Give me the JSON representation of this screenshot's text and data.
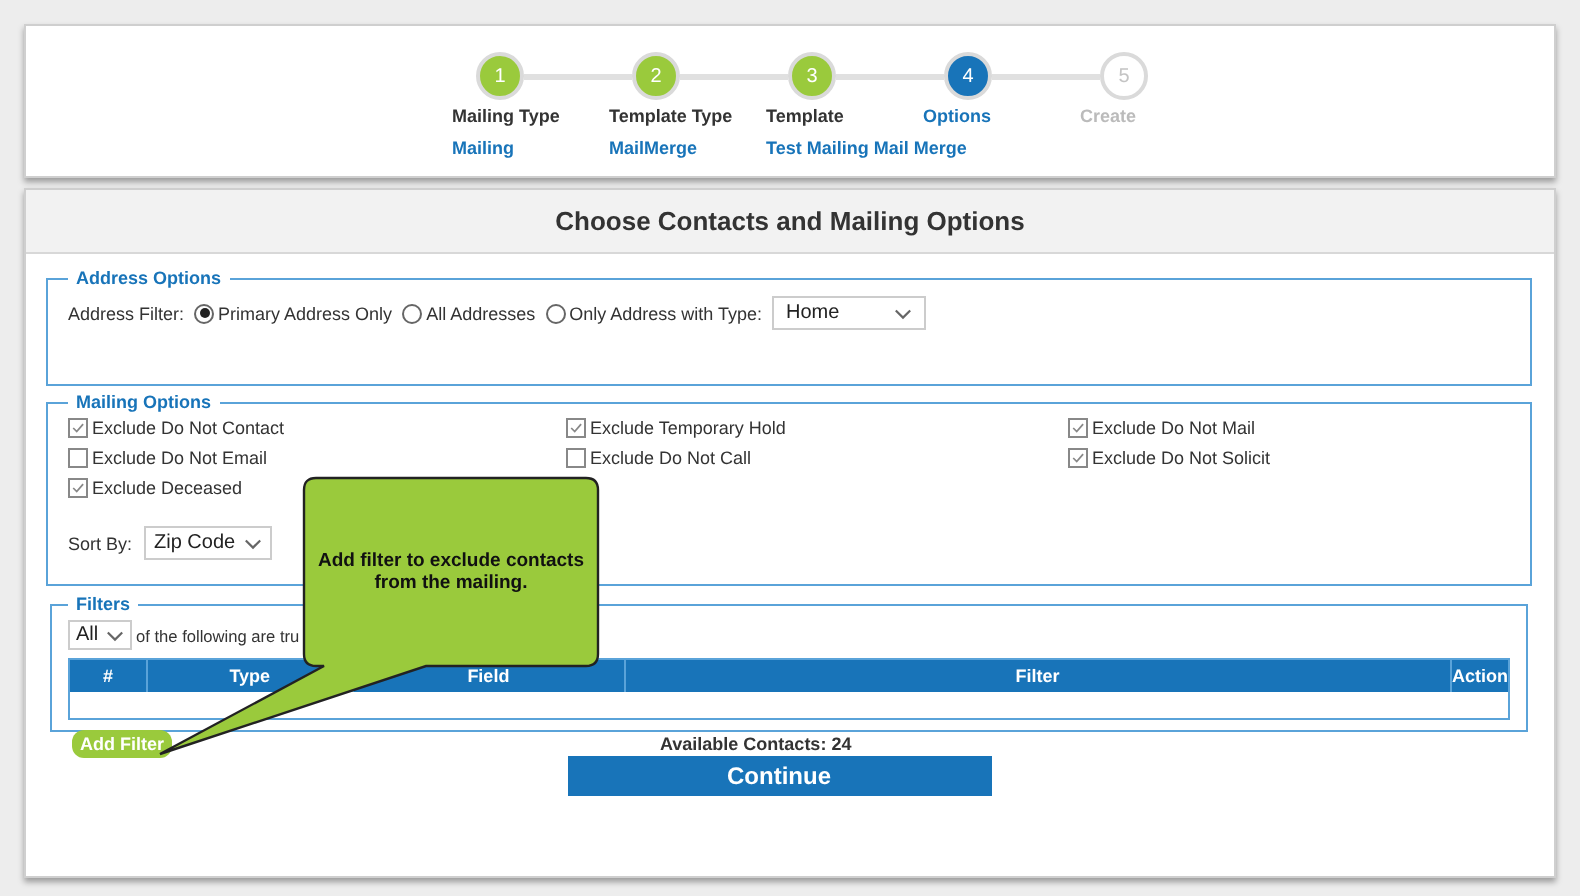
{
  "steps": [
    {
      "label": "Mailing Type",
      "number": "1",
      "kind": "done",
      "value": "Mailing"
    },
    {
      "label": "Template Type",
      "number": "2",
      "kind": "done",
      "value": "MailMerge"
    },
    {
      "label": "Template",
      "number": "3",
      "kind": "done",
      "value": "Test Mailing Mail Merge"
    },
    {
      "label": "Options",
      "number": "4",
      "kind": "current"
    },
    {
      "label": "Create",
      "number": "5",
      "kind": "pending"
    }
  ],
  "page_title": "Choose Contacts and Mailing Options",
  "address_options": {
    "legend": "Address Options",
    "filter_label": "Address Filter:",
    "radios": [
      {
        "label": "Primary Address Only",
        "selected": true
      },
      {
        "label": "All Addresses",
        "selected": false
      },
      {
        "label": "Only Address with Type:",
        "selected": false
      }
    ],
    "type_select": "Home"
  },
  "mailing_options": {
    "legend": "Mailing Options",
    "checkboxes": [
      {
        "label": "Exclude Do Not Contact",
        "checked": true
      },
      {
        "label": "Exclude Temporary Hold",
        "checked": true
      },
      {
        "label": "Exclude Do Not Mail",
        "checked": true
      },
      {
        "label": "Exclude Do Not Email",
        "checked": false
      },
      {
        "label": "Exclude Do Not Call",
        "checked": false
      },
      {
        "label": "Exclude Do Not Solicit",
        "checked": true
      },
      {
        "label": "Exclude Deceased",
        "checked": true
      }
    ],
    "sort_label": "Sort By:",
    "sort_select": "Zip Code"
  },
  "filters": {
    "legend": "Filters",
    "match_select": "All",
    "match_text": "of the following are tru",
    "table": {
      "columns": [
        "#",
        "Type",
        "Field",
        "Filter",
        "Action"
      ]
    },
    "add_button": "Add Filter",
    "available_contacts": "Available Contacts: 24"
  },
  "continue_button": "Continue",
  "callout": {
    "text": "Add filter to exclude contacts from the mailing."
  }
}
